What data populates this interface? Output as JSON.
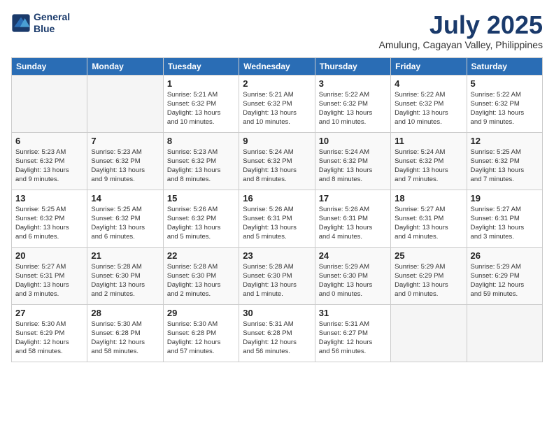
{
  "logo": {
    "line1": "General",
    "line2": "Blue"
  },
  "title": "July 2025",
  "location": "Amulung, Cagayan Valley, Philippines",
  "headers": [
    "Sunday",
    "Monday",
    "Tuesday",
    "Wednesday",
    "Thursday",
    "Friday",
    "Saturday"
  ],
  "weeks": [
    [
      {
        "day": "",
        "detail": ""
      },
      {
        "day": "",
        "detail": ""
      },
      {
        "day": "1",
        "detail": "Sunrise: 5:21 AM\nSunset: 6:32 PM\nDaylight: 13 hours\nand 10 minutes."
      },
      {
        "day": "2",
        "detail": "Sunrise: 5:21 AM\nSunset: 6:32 PM\nDaylight: 13 hours\nand 10 minutes."
      },
      {
        "day": "3",
        "detail": "Sunrise: 5:22 AM\nSunset: 6:32 PM\nDaylight: 13 hours\nand 10 minutes."
      },
      {
        "day": "4",
        "detail": "Sunrise: 5:22 AM\nSunset: 6:32 PM\nDaylight: 13 hours\nand 10 minutes."
      },
      {
        "day": "5",
        "detail": "Sunrise: 5:22 AM\nSunset: 6:32 PM\nDaylight: 13 hours\nand 9 minutes."
      }
    ],
    [
      {
        "day": "6",
        "detail": "Sunrise: 5:23 AM\nSunset: 6:32 PM\nDaylight: 13 hours\nand 9 minutes."
      },
      {
        "day": "7",
        "detail": "Sunrise: 5:23 AM\nSunset: 6:32 PM\nDaylight: 13 hours\nand 9 minutes."
      },
      {
        "day": "8",
        "detail": "Sunrise: 5:23 AM\nSunset: 6:32 PM\nDaylight: 13 hours\nand 8 minutes."
      },
      {
        "day": "9",
        "detail": "Sunrise: 5:24 AM\nSunset: 6:32 PM\nDaylight: 13 hours\nand 8 minutes."
      },
      {
        "day": "10",
        "detail": "Sunrise: 5:24 AM\nSunset: 6:32 PM\nDaylight: 13 hours\nand 8 minutes."
      },
      {
        "day": "11",
        "detail": "Sunrise: 5:24 AM\nSunset: 6:32 PM\nDaylight: 13 hours\nand 7 minutes."
      },
      {
        "day": "12",
        "detail": "Sunrise: 5:25 AM\nSunset: 6:32 PM\nDaylight: 13 hours\nand 7 minutes."
      }
    ],
    [
      {
        "day": "13",
        "detail": "Sunrise: 5:25 AM\nSunset: 6:32 PM\nDaylight: 13 hours\nand 6 minutes."
      },
      {
        "day": "14",
        "detail": "Sunrise: 5:25 AM\nSunset: 6:32 PM\nDaylight: 13 hours\nand 6 minutes."
      },
      {
        "day": "15",
        "detail": "Sunrise: 5:26 AM\nSunset: 6:32 PM\nDaylight: 13 hours\nand 5 minutes."
      },
      {
        "day": "16",
        "detail": "Sunrise: 5:26 AM\nSunset: 6:31 PM\nDaylight: 13 hours\nand 5 minutes."
      },
      {
        "day": "17",
        "detail": "Sunrise: 5:26 AM\nSunset: 6:31 PM\nDaylight: 13 hours\nand 4 minutes."
      },
      {
        "day": "18",
        "detail": "Sunrise: 5:27 AM\nSunset: 6:31 PM\nDaylight: 13 hours\nand 4 minutes."
      },
      {
        "day": "19",
        "detail": "Sunrise: 5:27 AM\nSunset: 6:31 PM\nDaylight: 13 hours\nand 3 minutes."
      }
    ],
    [
      {
        "day": "20",
        "detail": "Sunrise: 5:27 AM\nSunset: 6:31 PM\nDaylight: 13 hours\nand 3 minutes."
      },
      {
        "day": "21",
        "detail": "Sunrise: 5:28 AM\nSunset: 6:30 PM\nDaylight: 13 hours\nand 2 minutes."
      },
      {
        "day": "22",
        "detail": "Sunrise: 5:28 AM\nSunset: 6:30 PM\nDaylight: 13 hours\nand 2 minutes."
      },
      {
        "day": "23",
        "detail": "Sunrise: 5:28 AM\nSunset: 6:30 PM\nDaylight: 13 hours\nand 1 minute."
      },
      {
        "day": "24",
        "detail": "Sunrise: 5:29 AM\nSunset: 6:30 PM\nDaylight: 13 hours\nand 0 minutes."
      },
      {
        "day": "25",
        "detail": "Sunrise: 5:29 AM\nSunset: 6:29 PM\nDaylight: 13 hours\nand 0 minutes."
      },
      {
        "day": "26",
        "detail": "Sunrise: 5:29 AM\nSunset: 6:29 PM\nDaylight: 12 hours\nand 59 minutes."
      }
    ],
    [
      {
        "day": "27",
        "detail": "Sunrise: 5:30 AM\nSunset: 6:29 PM\nDaylight: 12 hours\nand 58 minutes."
      },
      {
        "day": "28",
        "detail": "Sunrise: 5:30 AM\nSunset: 6:28 PM\nDaylight: 12 hours\nand 58 minutes."
      },
      {
        "day": "29",
        "detail": "Sunrise: 5:30 AM\nSunset: 6:28 PM\nDaylight: 12 hours\nand 57 minutes."
      },
      {
        "day": "30",
        "detail": "Sunrise: 5:31 AM\nSunset: 6:28 PM\nDaylight: 12 hours\nand 56 minutes."
      },
      {
        "day": "31",
        "detail": "Sunrise: 5:31 AM\nSunset: 6:27 PM\nDaylight: 12 hours\nand 56 minutes."
      },
      {
        "day": "",
        "detail": ""
      },
      {
        "day": "",
        "detail": ""
      }
    ]
  ]
}
